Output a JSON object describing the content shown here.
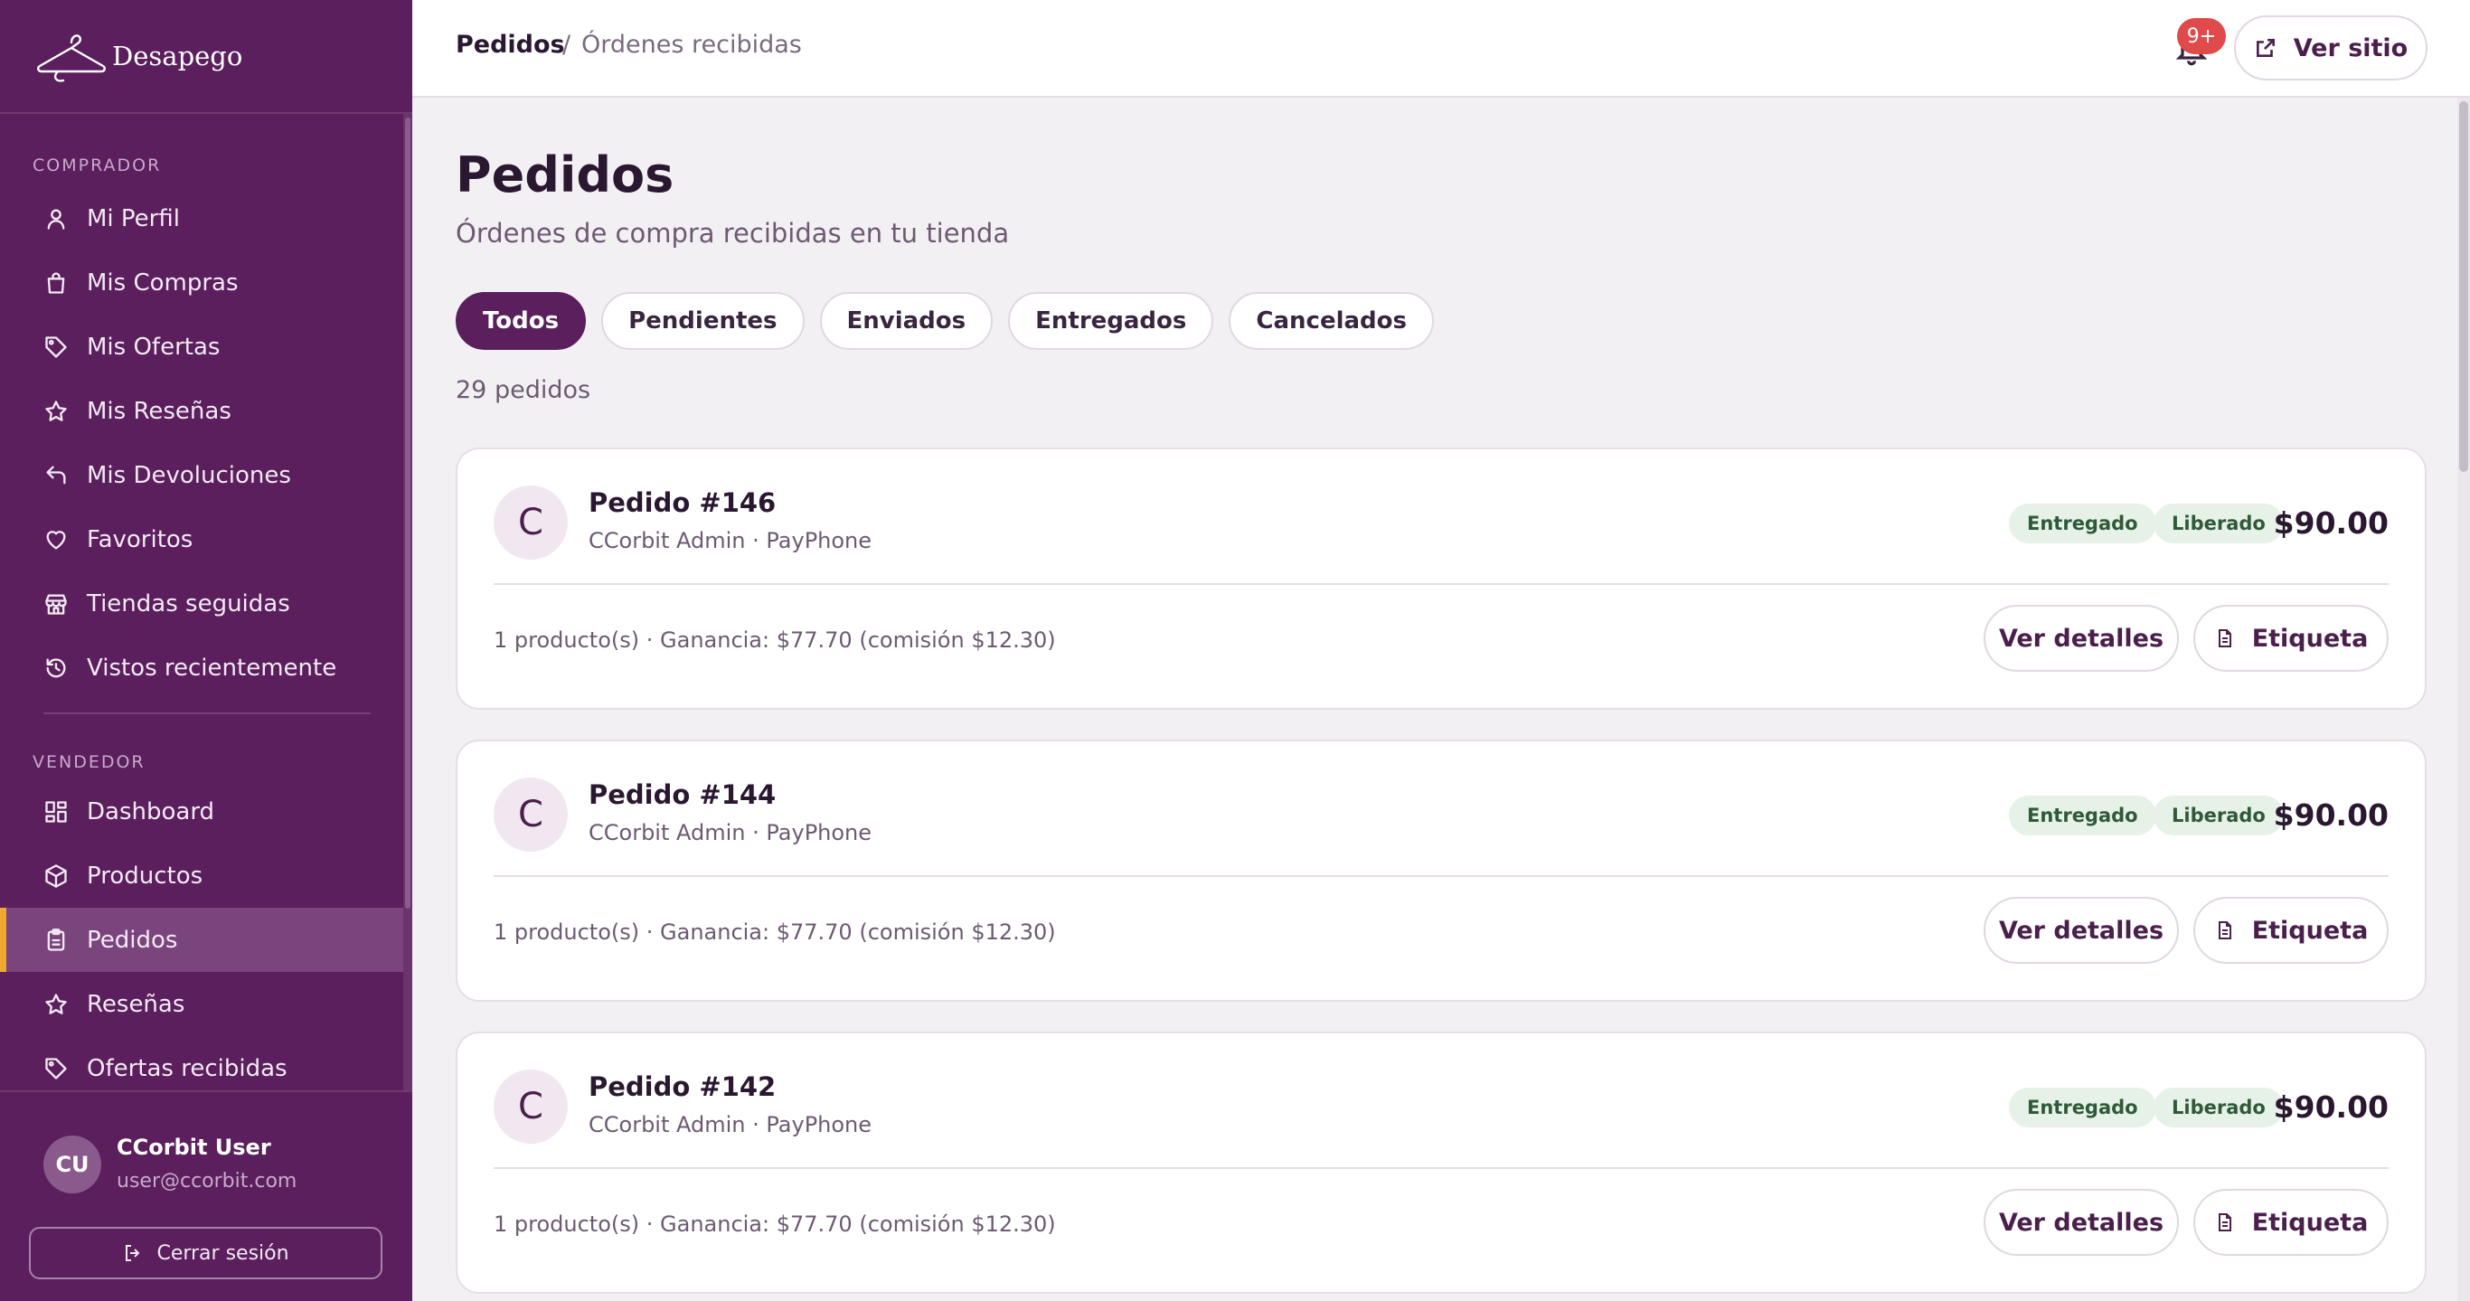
{
  "brand": {
    "name": "Desapego"
  },
  "sidebar": {
    "buyer_section": "COMPRADOR",
    "buyer_items": [
      {
        "label": "Mi Perfil",
        "icon": "user-icon"
      },
      {
        "label": "Mis Compras",
        "icon": "shopping-bag-icon"
      },
      {
        "label": "Mis Ofertas",
        "icon": "tag-icon"
      },
      {
        "label": "Mis Reseñas",
        "icon": "star-icon"
      },
      {
        "label": "Mis Devoluciones",
        "icon": "return-arrow-icon"
      },
      {
        "label": "Favoritos",
        "icon": "heart-icon"
      },
      {
        "label": "Tiendas seguidas",
        "icon": "store-icon"
      },
      {
        "label": "Vistos recientemente",
        "icon": "history-icon"
      }
    ],
    "seller_section": "VENDEDOR",
    "seller_items": [
      {
        "label": "Dashboard",
        "icon": "dashboard-icon"
      },
      {
        "label": "Productos",
        "icon": "box-icon"
      },
      {
        "label": "Pedidos",
        "icon": "clipboard-icon",
        "active": true
      },
      {
        "label": "Reseñas",
        "icon": "star-icon"
      },
      {
        "label": "Ofertas recibidas",
        "icon": "tag-icon"
      }
    ],
    "active_accent": "#f0a830",
    "background": "#5a1f5c"
  },
  "user": {
    "initials": "CU",
    "name": "CCorbit User",
    "email": "user@ccorbit.com",
    "logout_label": "Cerrar sesión"
  },
  "header": {
    "breadcrumb_main": "Pedidos",
    "breadcrumb_sep": "/",
    "breadcrumb_sub": "Órdenes recibidas",
    "notifications_badge": "9+",
    "view_site_label": "Ver sitio"
  },
  "main": {
    "title": "Pedidos",
    "subtitle": "Órdenes de compra recibidas en tu tienda",
    "filters": [
      {
        "label": "Todos",
        "active": true
      },
      {
        "label": "Pendientes"
      },
      {
        "label": "Enviados"
      },
      {
        "label": "Entregados"
      },
      {
        "label": "Cancelados"
      }
    ],
    "count_label": "29 pedidos"
  },
  "orders": [
    {
      "initial": "C",
      "title": "Pedido #146",
      "meta": "CCorbit Admin · PayPhone",
      "status": "Entregado",
      "payout": "Liberado",
      "price": "$90.00",
      "summary": "1 producto(s) · Ganancia: $77.70 (comisión $12.30)",
      "details_label": "Ver detalles",
      "label_label": "Etiqueta"
    },
    {
      "initial": "C",
      "title": "Pedido #144",
      "meta": "CCorbit Admin · PayPhone",
      "status": "Entregado",
      "payout": "Liberado",
      "price": "$90.00",
      "summary": "1 producto(s) · Ganancia: $77.70 (comisión $12.30)",
      "details_label": "Ver detalles",
      "label_label": "Etiqueta"
    },
    {
      "initial": "C",
      "title": "Pedido #142",
      "meta": "CCorbit Admin · PayPhone",
      "status": "Entregado",
      "payout": "Liberado",
      "price": "$90.00",
      "summary": "1 producto(s) · Ganancia: $77.70 (comisión $12.30)",
      "details_label": "Ver detalles",
      "label_label": "Etiqueta"
    }
  ],
  "colors": {
    "primary": "#5a1f5c",
    "badge_bg": "#e6f1e8",
    "badge_text": "#2f5a39",
    "notification": "#e14a4a"
  }
}
